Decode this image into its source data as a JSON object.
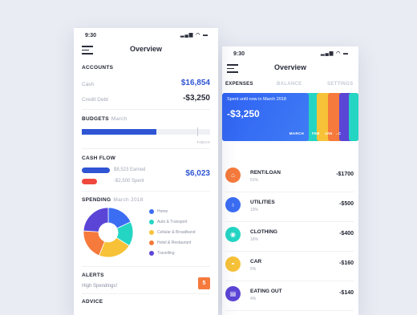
{
  "left_phone": {
    "status_time": "9:30",
    "status_icons": "▂▄▆ ◠ ▬",
    "title": "Overview",
    "accounts": {
      "title": "ACCOUNTS",
      "cash_label": "Cash",
      "cash_value": "$16,854",
      "debt_label": "Credit Debt",
      "debt_value": "-$3,250"
    },
    "budgets": {
      "title": "BUDGETS",
      "month": "March",
      "progress_fraction": 0.58,
      "today_fraction": 0.9,
      "today_label": "TODAY"
    },
    "cash_flow": {
      "title": "CASH FLOW",
      "earned_text": "$8,523 Earned",
      "spent_text": "-$2,500 Spent",
      "total": "$6,023",
      "earned_color": "#2f55d4",
      "spent_color": "#f0483e"
    },
    "spending": {
      "title": "SPENDING",
      "month": "March 2018",
      "categories": [
        {
          "label": "Home",
          "color": "#3b6df3",
          "share": 0.18
        },
        {
          "label": "Auto & Transport",
          "color": "#25d5c4",
          "share": 0.16
        },
        {
          "label": "Cellular & Broadband",
          "color": "#f7c238",
          "share": 0.22
        },
        {
          "label": "Hotel & Restaurant",
          "color": "#f57a3c",
          "share": 0.2
        },
        {
          "label": "Travelling",
          "color": "#5a45d6",
          "share": 0.24
        }
      ]
    },
    "alerts": {
      "title": "ALERTS",
      "text": "High Spendings!",
      "count": "5"
    },
    "advice": {
      "title": "ADVICE"
    }
  },
  "right_phone": {
    "status_time": "9:30",
    "status_icons": "▂▄▆ ◠ ▬",
    "title": "Overview",
    "tabs": {
      "expenses": "EXPENSES",
      "balance": "BALANCE",
      "settings": "SETTINGS"
    },
    "card": {
      "caption": "Spent until now in March 2018",
      "amount": "-$3,250",
      "month": "MARCH",
      "colors": [
        "#25d5c4",
        "#f7c238",
        "#f57a3c",
        "#5a45d6",
        "#25d5c4"
      ],
      "strip_labels": [
        "FEB",
        "JAN",
        "..C"
      ]
    },
    "expenses": [
      {
        "name": "RENT/LOAN",
        "pct": "51%",
        "amount": "-$1700",
        "color": "#f57a3c",
        "icon": "⌂",
        "icon_name": "home-icon"
      },
      {
        "name": "UTILITIES",
        "pct": "19%",
        "amount": "-$500",
        "color": "#3b6df3",
        "icon": "♁",
        "icon_name": "bulb-icon"
      },
      {
        "name": "CLOTHING",
        "pct": "16%",
        "amount": "-$400",
        "color": "#25d5c4",
        "icon": "◉",
        "icon_name": "clothing-icon"
      },
      {
        "name": "CAR",
        "pct": "5%",
        "amount": "-$160",
        "color": "#f7c238",
        "icon": "◓",
        "icon_name": "car-icon"
      },
      {
        "name": "EATING OUT",
        "pct": "4%",
        "amount": "-$140",
        "color": "#5a45d6",
        "icon": "▤",
        "icon_name": "restaurant-icon"
      }
    ]
  }
}
